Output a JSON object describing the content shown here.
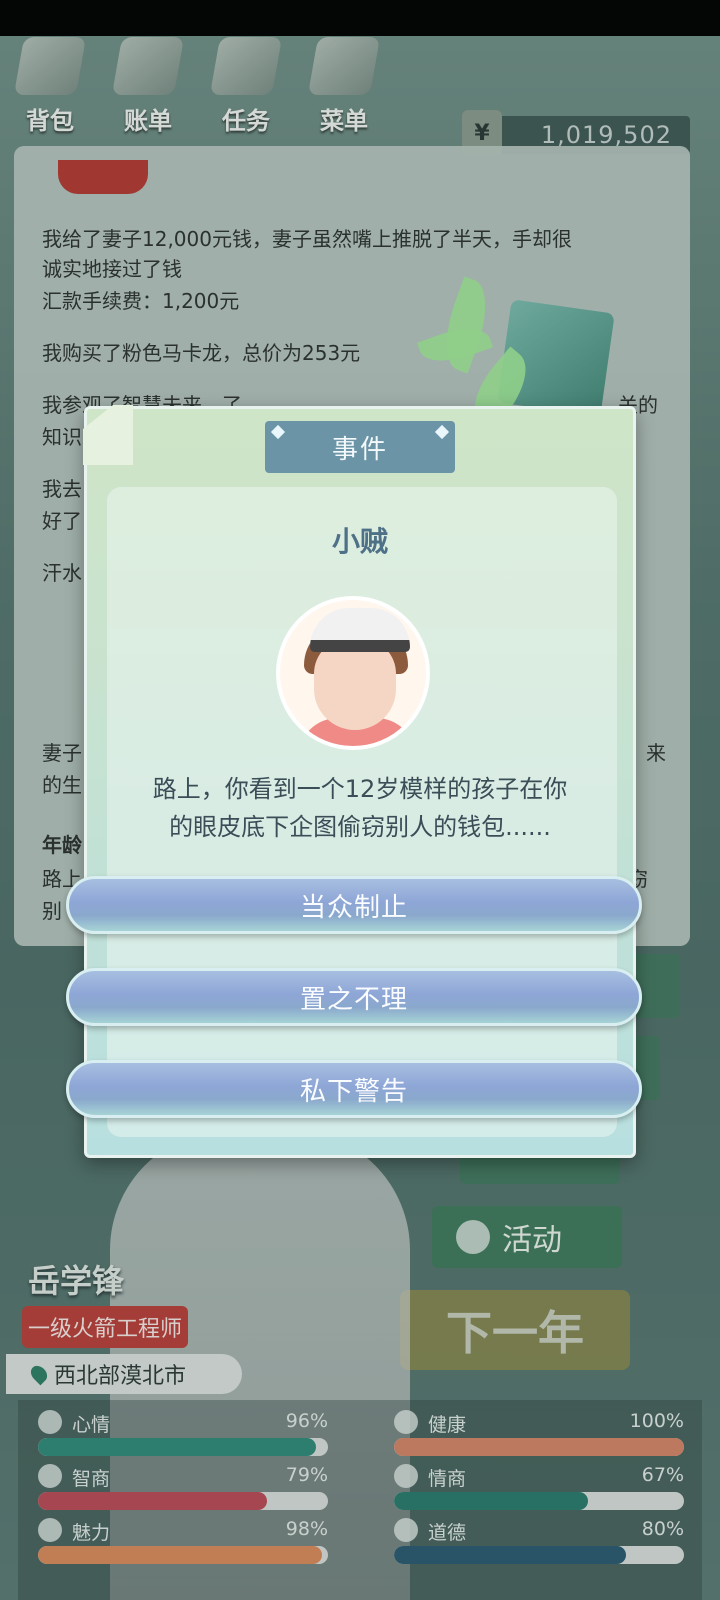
{
  "top_nav": {
    "items": [
      {
        "label": "背包"
      },
      {
        "label": "账单"
      },
      {
        "label": "任务"
      },
      {
        "label": "菜单"
      }
    ],
    "money": {
      "symbol": "¥",
      "amount": "1,019,502"
    }
  },
  "log": {
    "lines": [
      "我给了妻子12,000元钱，妻子虽然嘴上推脱了半天，手却很",
      "诚实地接过了钱",
      "汇款手续费：1,200元",
      "我购买了粉色马卡龙，总价为253元",
      "我参观了智慧未来，了",
      "知识",
      "我去",
      "好了",
      "汗水",
      "妻子",
      "的生",
      "年龄",
      "路上",
      "别"
    ],
    "fragments": [
      "关的",
      "来",
      "窃",
      ","
    ]
  },
  "side": {
    "activity_label": "活动",
    "next_year_label": "下一年"
  },
  "character": {
    "name": "岳学锋",
    "title": "一级火箭工程师",
    "location": "西北部漠北市",
    "badge": "I03"
  },
  "stats": [
    {
      "label": "心情",
      "percent_text": "96%",
      "value": 0.96,
      "color": "#2f8a78"
    },
    {
      "label": "健康",
      "percent_text": "100%",
      "value": 1.0,
      "color": "#d28467"
    },
    {
      "label": "智商",
      "percent_text": "79%",
      "value": 0.79,
      "color": "#b84a56"
    },
    {
      "label": "情商",
      "percent_text": "67%",
      "value": 0.67,
      "color": "#2a7a6d"
    },
    {
      "label": "魅力",
      "percent_text": "98%",
      "value": 0.98,
      "color": "#d88a5a"
    },
    {
      "label": "道德",
      "percent_text": "80%",
      "value": 0.8,
      "color": "#2b5a70"
    }
  ],
  "modal": {
    "tab_label": "事件",
    "title": "小贼",
    "description_line1": "路上，你看到一个12岁模样的孩子在你",
    "description_line2": "的眼皮底下企图偷窃别人的钱包......",
    "choices": [
      "当众制止",
      "置之不理",
      "私下警告"
    ]
  }
}
